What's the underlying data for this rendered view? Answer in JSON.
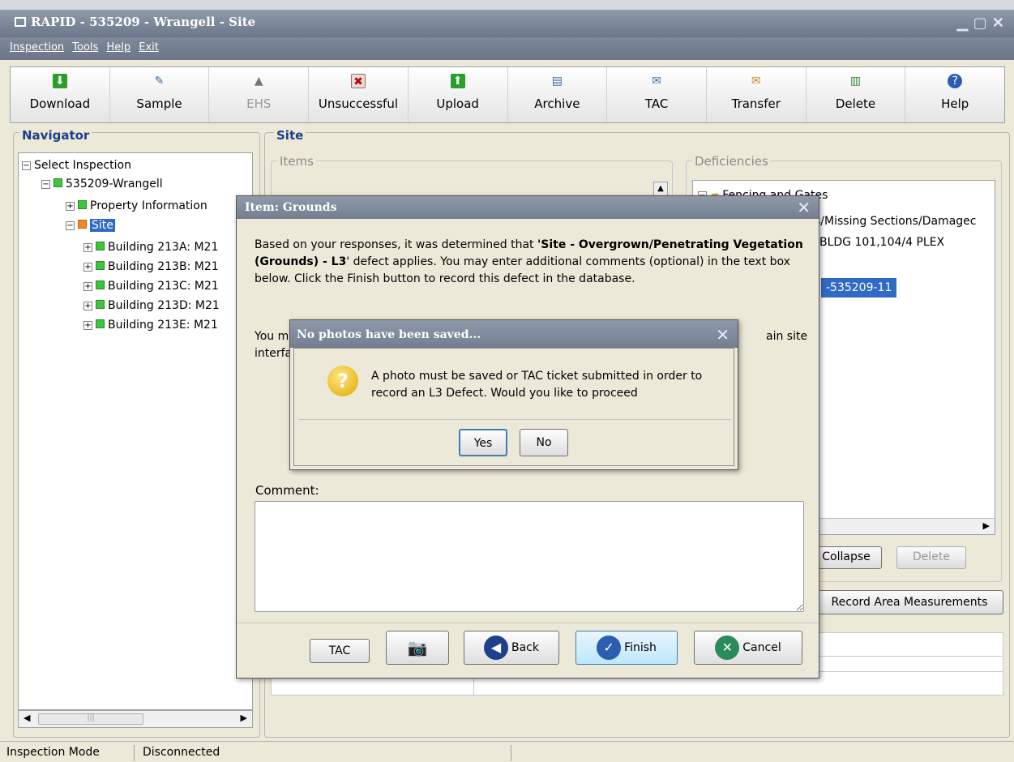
{
  "window": {
    "title": "RAPID - 535209 - Wrangell - Site"
  },
  "menu": [
    "Inspection",
    "Tools",
    "Help",
    "Exit"
  ],
  "toolbar": [
    {
      "label": "Download",
      "icon": "download-icon",
      "enabled": true
    },
    {
      "label": "Sample",
      "icon": "sample-icon",
      "enabled": true
    },
    {
      "label": "EHS",
      "icon": "warning-icon",
      "enabled": false
    },
    {
      "label": "Unsuccessful",
      "icon": "unsuccessful-icon",
      "enabled": true
    },
    {
      "label": "Upload",
      "icon": "upload-icon",
      "enabled": true
    },
    {
      "label": "Archive",
      "icon": "archive-icon",
      "enabled": true
    },
    {
      "label": "TAC",
      "icon": "tac-icon",
      "enabled": true
    },
    {
      "label": "Transfer",
      "icon": "transfer-icon",
      "enabled": true
    },
    {
      "label": "Delete",
      "icon": "delete-icon",
      "enabled": true
    },
    {
      "label": "Help",
      "icon": "help-icon",
      "enabled": true
    }
  ],
  "navigator": {
    "title": "Navigator",
    "tree": [
      {
        "label": "Select Inspection",
        "level": 0
      },
      {
        "label": "535209-Wrangell",
        "level": 1
      },
      {
        "label": "Property Information",
        "level": 2
      },
      {
        "label": "Site",
        "level": 2,
        "selected": true
      },
      {
        "label": "Building 213A: M21",
        "level": 3
      },
      {
        "label": "Building 213B: M21",
        "level": 3
      },
      {
        "label": "Building 213C: M21",
        "level": 3
      },
      {
        "label": "Building 213D: M21",
        "level": 3
      },
      {
        "label": "Building 213E: M21",
        "level": 3
      }
    ]
  },
  "site": {
    "title": "Site",
    "items_label": "Items",
    "deficiencies_label": "Deficiencies",
    "deficiencies": [
      "Fencing and Gates",
      "s/Missing Sections/Damagec",
      "BLDG 101,104/4 PLEX",
      "-535209-11"
    ],
    "collapse_label": "Collapse",
    "delete_label": "Delete",
    "record_area_label": "Record Area Measurements"
  },
  "dialog": {
    "title": "Item: Grounds",
    "text_pre": "Based on your responses, it was determined that ",
    "text_bold": "'Site - Overgrown/Penetrating Vegetation (Grounds) - L3",
    "text_post": "' defect applies. You may enter additional comments (optional) in the text box below. Click the Finish button to record this defect in the database.",
    "text2": "You m",
    "text2b": "interfa",
    "text3": "ain site",
    "comment_label": "Comment:",
    "buttons": {
      "tac": "TAC",
      "back": "Back",
      "finish": "Finish",
      "cancel": "Cancel"
    }
  },
  "confirm": {
    "title": "No photos have been saved...",
    "message_line1": "A photo must be saved or TAC ticket submitted in order to",
    "message_line2": "record an L3 Defect. Would you like to proceed",
    "yes": "Yes",
    "no": "No"
  },
  "status": {
    "mode": "Inspection Mode",
    "connection": "Disconnected"
  }
}
